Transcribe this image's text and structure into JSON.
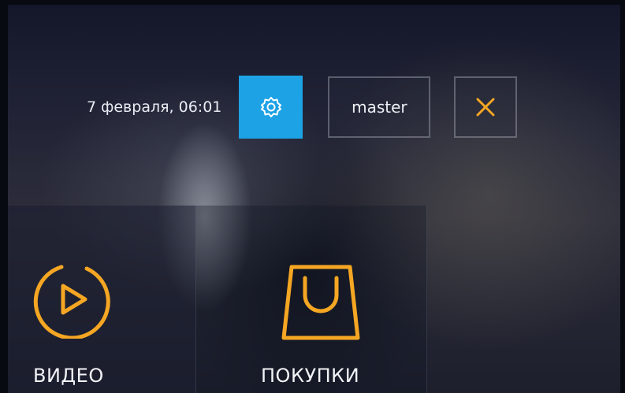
{
  "header": {
    "datetime": "7 февраля, 06:01",
    "user_label": "master",
    "settings_icon": "gear-icon",
    "close_icon": "close-icon"
  },
  "tiles": [
    {
      "label": "ВИДЕО",
      "icon": "play-circle-icon"
    },
    {
      "label": "ПОКУПКИ",
      "icon": "shopping-bag-icon"
    }
  ],
  "colors": {
    "accent": "#1EA2E6",
    "icon_orange": "#F5A623",
    "text": "#EEF0F5"
  }
}
